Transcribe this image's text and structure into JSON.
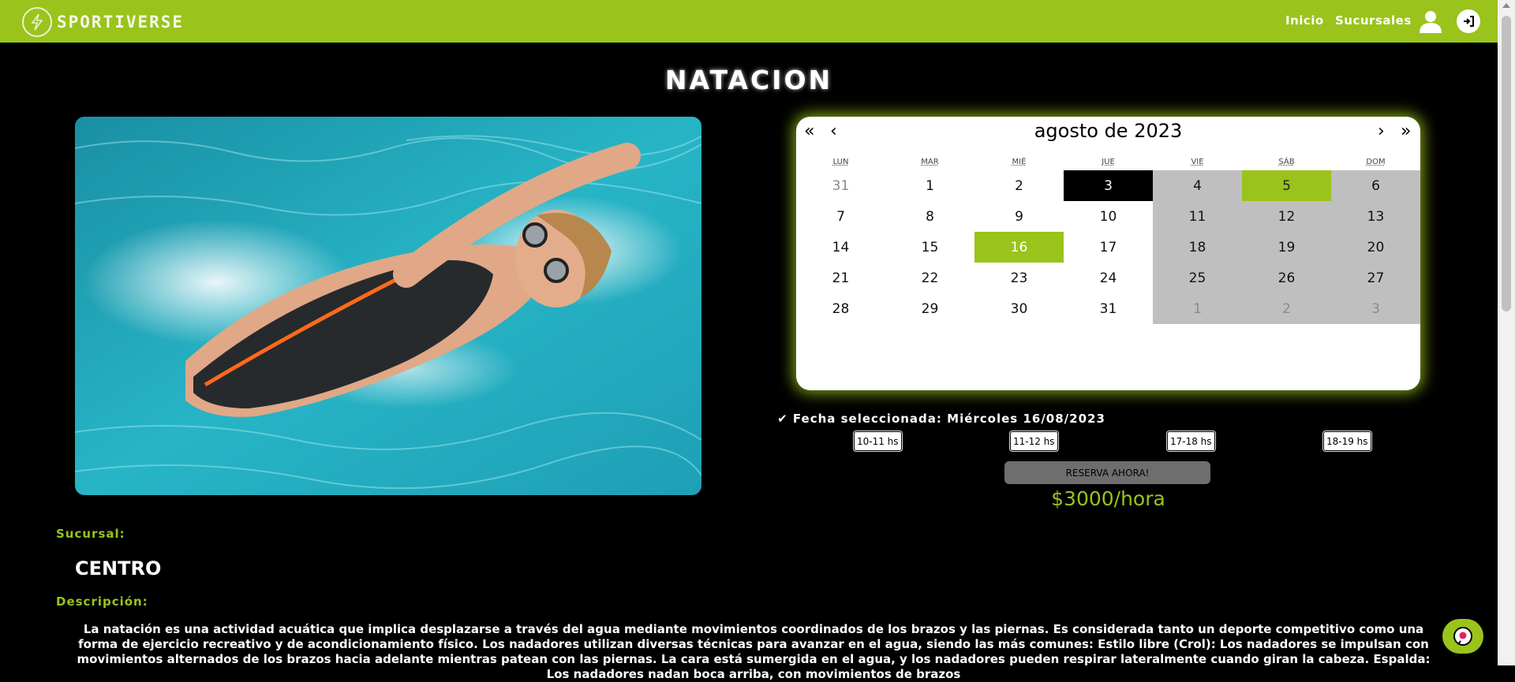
{
  "navbar": {
    "brand": "SPORTIVERSE",
    "links": [
      "Inicio",
      "Sucursales"
    ],
    "user_icon": "user-icon",
    "login_icon": "sign-in-icon",
    "color": "#9ac31c"
  },
  "page": {
    "title": "NATACION"
  },
  "calendar": {
    "title": "agosto de 2023",
    "nav": {
      "prev_year": "«",
      "prev": "‹",
      "next": "›",
      "next_year": "»"
    },
    "weekdays": [
      "LUN",
      "MAR",
      "MIÉ",
      "JUE",
      "VIE",
      "SÁB",
      "DOM"
    ],
    "weeks": [
      [
        "31",
        "1",
        "2",
        "3",
        "4",
        "5",
        "6"
      ],
      [
        "7",
        "8",
        "9",
        "10",
        "11",
        "12",
        "13"
      ],
      [
        "14",
        "15",
        "16",
        "17",
        "18",
        "19",
        "20"
      ],
      [
        "21",
        "22",
        "23",
        "24",
        "25",
        "26",
        "27"
      ],
      [
        "28",
        "29",
        "30",
        "31",
        "1",
        "2",
        "3"
      ]
    ],
    "today": "3",
    "selected": "16",
    "highlighted": "5"
  },
  "booking": {
    "selected_label": "✔ Fecha seleccionada: Miércoles 16/08/2023",
    "time_slots": [
      "10-11 hs",
      "11-12 hs",
      "17-18 hs",
      "18-19 hs"
    ],
    "reserve_label": "RESERVA AHORA!",
    "price": "$3000/hora"
  },
  "details": {
    "branch_label": "Sucursal:",
    "branch_name": "CENTRO",
    "description_label": "Descripción:",
    "description": "La natación es una actividad acuática que implica desplazarse a través del agua mediante movimientos coordinados de los brazos y las piernas. Es considerada tanto un deporte competitivo como una forma de ejercicio recreativo y de acondicionamiento físico. Los nadadores utilizan diversas técnicas para avanzar en el agua, siendo las más comunes: Estilo libre (Crol): Los nadadores se impulsan con movimientos alternados de los brazos hacia adelante mientras patean con las piernas. La cara está sumergida en el agua, y los nadadores pueden respirar lateralmente cuando giran la cabeza. Espalda: Los nadadores nadan boca arriba, con movimientos de brazos"
  },
  "chat": {
    "icon": "chat-bot-icon"
  }
}
